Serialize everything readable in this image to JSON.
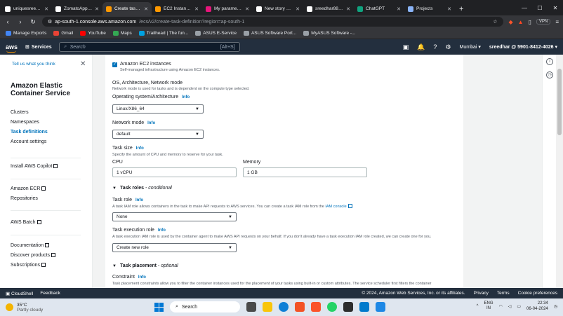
{
  "browser": {
    "tabs": [
      {
        "title": "uniquesreedhar/...",
        "color": "#ffffff",
        "active": false
      },
      {
        "title": "ZomatoApp-Clo...",
        "color": "#ffffff",
        "active": false
      },
      {
        "title": "Create task d...",
        "color": "#ff9900",
        "active": true
      },
      {
        "title": "EC2 Instance Co...",
        "color": "#ff9900",
        "active": false
      },
      {
        "title": "My parameters - ...",
        "color": "#e7157b",
        "active": false
      },
      {
        "title": "New story – Med...",
        "color": "#ffffff",
        "active": false
      },
      {
        "title": "sreedhar8897/sec...",
        "color": "#ffffff",
        "active": false
      },
      {
        "title": "ChatGPT",
        "color": "#10a37f",
        "active": false
      },
      {
        "title": "Projects",
        "color": "#8ab4f8",
        "active": false
      }
    ],
    "new_tab": "+",
    "url_host": "ap-south-1.console.aws.amazon.com",
    "url_path": "/ecs/v2/create-task-definition?region=ap-south-1",
    "vpn_label": "VPN",
    "bookmarks": [
      {
        "label": "Manage Exports",
        "color": "#4285f4"
      },
      {
        "label": "Gmail",
        "color": "#ea4335"
      },
      {
        "label": "YouTube",
        "color": "#ff0000"
      },
      {
        "label": "Maps",
        "color": "#34a853"
      },
      {
        "label": "Trailhead | The fun...",
        "color": "#00a1e0"
      },
      {
        "label": "ASUS E-Service",
        "color": "#9aa0a6"
      },
      {
        "label": "ASUS Software Port...",
        "color": "#9aa0a6"
      },
      {
        "label": "MyASUS Software -...",
        "color": "#9aa0a6"
      }
    ]
  },
  "aws_nav": {
    "logo": "aws",
    "services": "Services",
    "search_placeholder": "Search",
    "search_shortcut": "[Alt+S]",
    "region": "Mumbai ▾",
    "account": "sreedhar @ 5901-8412-4026 ▾"
  },
  "sidebar": {
    "tell_us": "Tell us what you think",
    "title": "Amazon Elastic Container Service",
    "items": [
      {
        "label": "Clusters",
        "active": false
      },
      {
        "label": "Namespaces",
        "active": false
      },
      {
        "label": "Task definitions",
        "active": true
      },
      {
        "label": "Account settings",
        "active": false
      }
    ],
    "copilot": "Install AWS Copilot",
    "ecr": "Amazon ECR",
    "repositories": "Repositories",
    "batch": "AWS Batch",
    "documentation": "Documentation",
    "discover": "Discover products",
    "subscriptions": "Subscriptions"
  },
  "form": {
    "ec2_checkbox_label": "Amazon EC2 instances",
    "ec2_checkbox_desc": "Self-managed infrastructure using Amazon EC2 instances.",
    "os_heading": "OS, Architecture, Network mode",
    "os_heading_desc": "Network mode is used for tasks and is dependent on the compute type selected.",
    "os_label": "Operating system/Architecture",
    "info": "Info",
    "os_value": "Linux/X86_64",
    "network_label": "Network mode",
    "network_value": "default",
    "task_size_label": "Task size",
    "task_size_desc": "Specify the amount of CPU and memory to reserve for your task.",
    "cpu_label": "CPU",
    "cpu_value": "1 vCPU",
    "memory_label": "Memory",
    "memory_value": "1 GB",
    "task_roles_title": "Task roles",
    "task_roles_suffix": "- conditional",
    "task_role_label": "Task role",
    "task_role_desc": "A task IAM role allows containers in the task to make API requests to AWS services. You can create a task IAM role from the",
    "iam_console": "IAM console",
    "task_role_value": "None",
    "exec_role_label": "Task execution role",
    "exec_role_desc": "A task execution IAM role is used by the container agent to make AWS API requests on your behalf. If you don't already have a task execution IAM role created, we can create one for you.",
    "exec_role_value": "Create new role",
    "placement_title": "Task placement",
    "placement_suffix": "- optional",
    "constraint_label": "Constraint",
    "constraint_desc": "Task placement constraints allow you to filter the container instances used for the placement of your tasks using built-in or custom attributes. The service scheduler first filters the container"
  },
  "footer": {
    "cloudshell": "CloudShell",
    "feedback": "Feedback",
    "copyright": "© 2024, Amazon Web Services, Inc. or its affiliates.",
    "privacy": "Privacy",
    "terms": "Terms",
    "cookies": "Cookie preferences"
  },
  "taskbar": {
    "temp": "35°C",
    "weather": "Partly cloudy",
    "search": "Search",
    "lang1": "ENG",
    "lang2": "IN",
    "time": "22:34",
    "date": "06-04-2024"
  }
}
